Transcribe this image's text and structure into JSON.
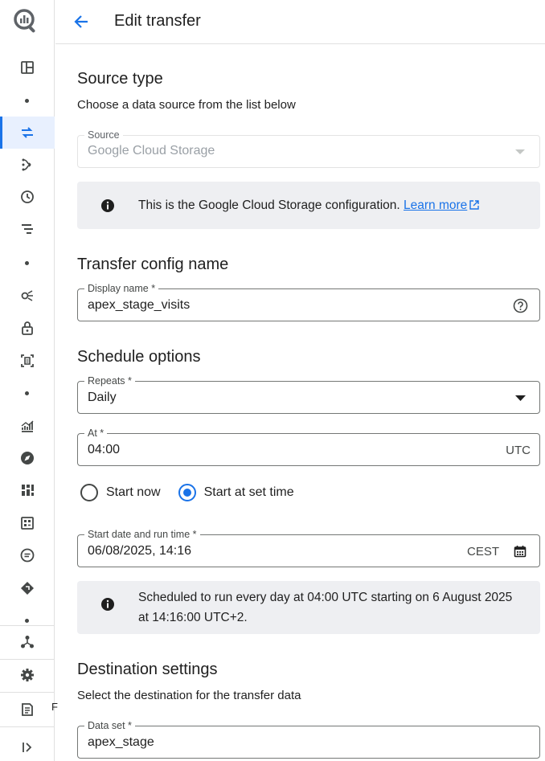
{
  "header": {
    "title": "Edit transfer"
  },
  "source_section": {
    "title": "Source type",
    "subtitle": "Choose a data source from the list below",
    "source_label": "Source",
    "source_value": "Google Cloud Storage",
    "info_text": "This is the Google Cloud Storage configuration.",
    "learn_more": "Learn more"
  },
  "config_section": {
    "title": "Transfer config name",
    "display_name_label": "Display name *",
    "display_name_value": "apex_stage_visits"
  },
  "schedule_section": {
    "title": "Schedule options",
    "repeats_label": "Repeats *",
    "repeats_value": "Daily",
    "at_label": "At *",
    "at_value": "04:00",
    "at_suffix": "UTC",
    "start_now_label": "Start now",
    "start_set_time_label": "Start at set time",
    "selected_start": "Start at set time",
    "start_date_label": "Start date and run time *",
    "start_date_value": "06/08/2025, 14:16",
    "start_date_suffix": "CEST",
    "info_line1": "Scheduled to run every day at 04:00 UTC starting on 6 August 2025",
    "info_line2": "at 14:16:00 UTC+2."
  },
  "destination_section": {
    "title": "Destination settings",
    "subtitle": "Select the destination for the transfer data",
    "dataset_label": "Data set *",
    "dataset_value": "apex_stage"
  },
  "rail": {
    "cut_text": "F",
    "icons": [
      "bigquery-logo",
      "overview-icon",
      "transfers-icon",
      "pipelines-icon",
      "scheduled-icon",
      "jobs-icon",
      "sharing-icon",
      "security-icon",
      "capacity-icon",
      "analytics-icon",
      "explore-icon",
      "dashboards-icon",
      "dataset-icon",
      "data-quality-icon",
      "partner-icon",
      "connections-icon",
      "settings-icon",
      "release-notes-icon",
      "expand-icon"
    ]
  },
  "colors": {
    "accent": "#1a73e8",
    "info_bg": "#eeeff2",
    "border": "#747775"
  }
}
